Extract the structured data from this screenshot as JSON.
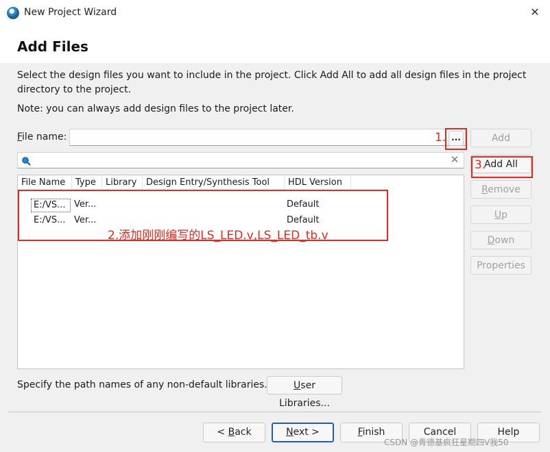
{
  "window": {
    "title": "New Project Wizard",
    "close_glyph": "✕"
  },
  "header": {
    "title": "Add Files"
  },
  "description": {
    "line1": "Select the design files you want to include in the project. Click Add All to add all design files in the project",
    "line2": "directory to the project.",
    "note": "Note: you can always add design files to the project later."
  },
  "file_name": {
    "label_u": "F",
    "label_rest": "ile name:",
    "value": "",
    "browse_label": "..."
  },
  "search": {
    "value": "",
    "clear_glyph": "✕",
    "icon": "search-icon"
  },
  "side_buttons": {
    "add": "Add",
    "add_all": "Add All",
    "remove_u": "R",
    "remove_rest": "emove",
    "up_u": "U",
    "up_rest": "p",
    "down_u": "D",
    "down_rest": "own",
    "properties": "Properties"
  },
  "table": {
    "columns": [
      "File Name",
      "Type",
      "Library",
      "Design Entry/Synthesis Tool",
      "HDL Version"
    ],
    "rows": [
      {
        "file": "E:/VS...",
        "type": "Ver...",
        "library": "",
        "tool": "",
        "hdl": "Default"
      },
      {
        "file": "E:/VS...",
        "type": "Ver...",
        "library": "",
        "tool": "",
        "hdl": "Default"
      }
    ]
  },
  "libraries": {
    "text": "Specify the path names of any non-default libraries.",
    "button_u": "U",
    "button_rest": "ser Libraries..."
  },
  "footer": {
    "back_pre": "< ",
    "back_u": "B",
    "back_rest": "ack",
    "next_u": "N",
    "next_rest": "ext >",
    "finish_u": "F",
    "finish_rest": "inish",
    "cancel": "Cancel",
    "help": "Help"
  },
  "annotations": {
    "step1": "1.",
    "step2": "2.添加刚刚编写的LS_LED.v,LS_LED_tb.v",
    "step3": "3."
  },
  "watermark": "CSDN @青德基疯狂星期四V我50",
  "colors": {
    "annotation_red": "#e5281e",
    "focus_blue": "#1a5fb4"
  }
}
